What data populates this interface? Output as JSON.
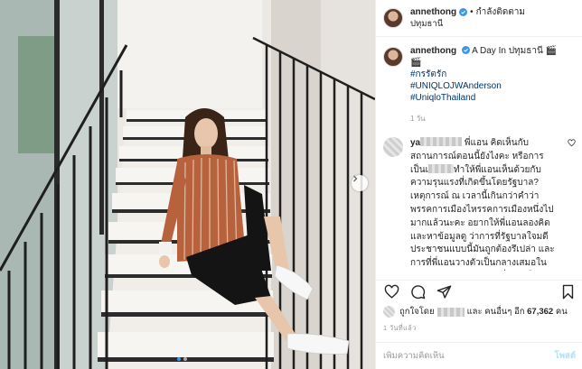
{
  "post": {
    "username": "annethong",
    "follow_label": "กำลังติดตาม",
    "separator": "•",
    "location": "ปทุมธานี"
  },
  "caption": {
    "username": "annethong",
    "text": "A Day In ปทุมธานี 🎬🎬",
    "tags": [
      "#กรรัตรัก",
      "#UNIQLOJWAnderson",
      "#UniqloThailand"
    ],
    "time": "1 วัน"
  },
  "comment": {
    "name_prefix": "ya",
    "part1": "พี่แอน คิดเห็นกับสถานการณ์ตอนนี้ยังไงคะ หรือการเป็นเ",
    "part2": "ทำให้พี่แอนเห็นด้วยกับความรุนแรงที่เกิดขึ้นโดยรัฐบาล? เหตุการณ์ ณ เวลานี้เกินกว่าคำว่าพรรคการเมืองไหรรคการเมืองหนึ่งไปมากแล้วนะคะ อยากให้พี่แอนลองคิดและหาข้อมูลดู ว่าการที่รัฐบาลใจมดีประชาชนแบบนี้มันถูกต้องรึเปล่า และการที่พี่แอนวางตัวเป็นกลางเสมอในทุกเหตุการณ์มันแปลว่าพี่แอนเห็นด้วยไปหมดคะ?? หรือเพราะต้องการ"
  },
  "likes": {
    "prefix": "ถูกใจโดย",
    "middle": "และ คนอื่นๆ อีก",
    "count": "67,362",
    "suffix": "คน"
  },
  "date": "1 วันที่แล้ว",
  "add_comment": {
    "placeholder": "เพิ่มความคิดเห็น",
    "post_label": "โพสต์"
  },
  "icons": {
    "verified": "verified-badge-icon",
    "more": "more-options-icon",
    "heart": "heart-icon",
    "comment": "comment-icon",
    "share": "share-icon",
    "save": "bookmark-icon",
    "next": "chevron-right-icon"
  },
  "colors": {
    "verified": "#3897f0",
    "tag": "#003569",
    "post_button": "#b2dffc",
    "muted": "#999999"
  }
}
